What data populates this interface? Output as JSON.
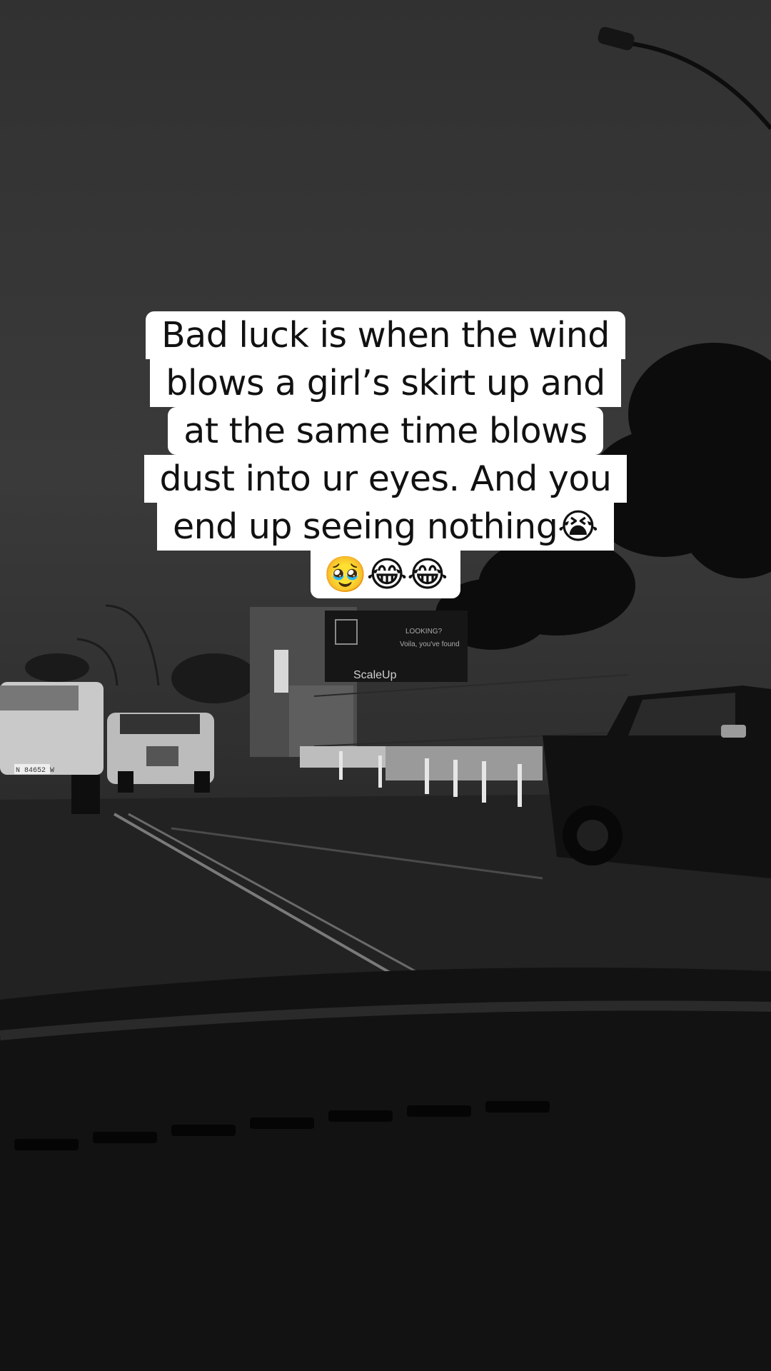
{
  "caption": {
    "lines": [
      "Bad luck is when the wind",
      "blows a girl’s skirt up and",
      "at the same time blows",
      "dust into ur eyes. And you",
      "end up seeing nothing😭",
      "🥹😂😂"
    ]
  },
  "background": {
    "sign_text_1": "LOOKING?",
    "sign_text_2": "Voila, you've found",
    "sign_text_3": "ScaleUp",
    "plate_text": "N 84652 W"
  }
}
